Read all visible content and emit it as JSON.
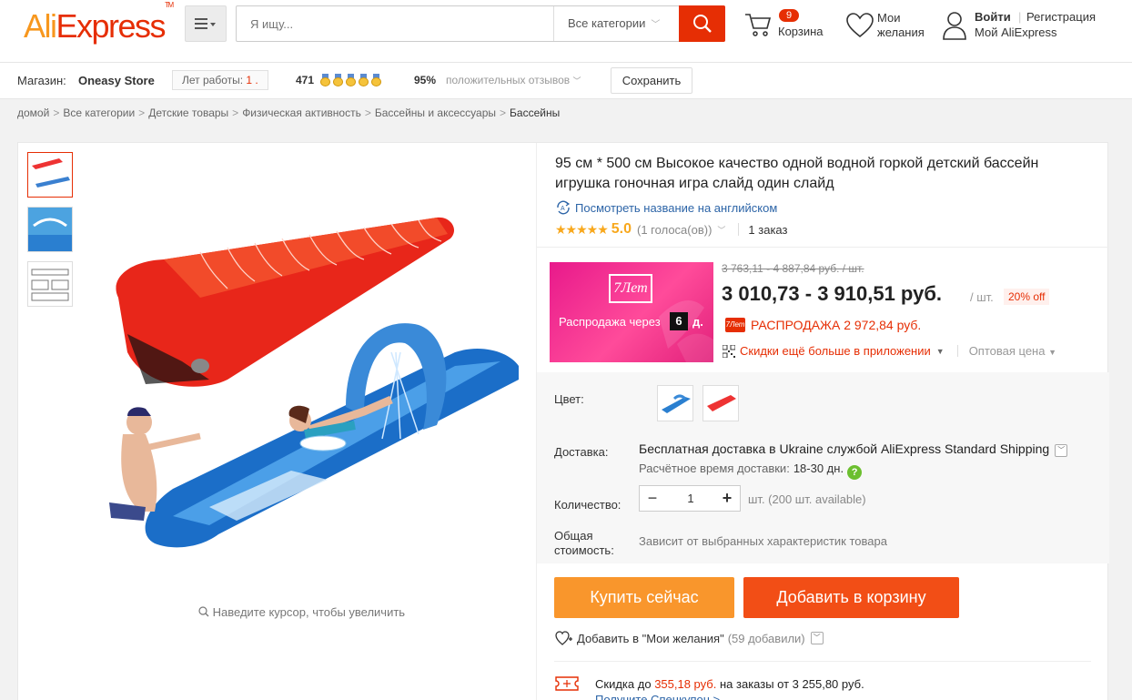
{
  "header": {
    "logo_ali": "Ali",
    "logo_express": "Express",
    "logo_tm": "TM",
    "search_placeholder": "Я ищу...",
    "category_select": "Все категории",
    "cart_count": "9",
    "cart_label": "Корзина",
    "wishlist_line1": "Мои",
    "wishlist_line2": "желания",
    "login": "Войти",
    "register": "Регистрация",
    "my_aliexpress": "Мой AliExpress"
  },
  "store": {
    "label": "Магазин:",
    "name": "Oneasy Store",
    "years_label": "Лет работы:",
    "years_value": "1 .",
    "score": "471",
    "positive_pct": "95%",
    "positive_label": "положительных отзывов",
    "save_button": "Сохранить"
  },
  "breadcrumb": [
    "домой",
    "Все категории",
    "Детские товары",
    "Физическая активность",
    "Бассейны и аксессуары",
    "Бассейны"
  ],
  "gallery": {
    "zoom_hint": "Наведите курсор, чтобы увеличить"
  },
  "product": {
    "title": "95 см * 500 см Высокое качество одной водной горкой детский бассейн игрушка гоночная игра слайд один слайд",
    "translate_link": "Посмотреть название на английском",
    "stars": "★★★★★",
    "rating": "5.0",
    "votes": "(1 голоса(ов))",
    "orders": "1 заказ"
  },
  "promo": {
    "logo": "7Лет",
    "sale_in": "Распродажа через",
    "days": "6",
    "days_unit": "д."
  },
  "pricing": {
    "old_price": "3 763,11 - 4 887,84 руб. / шт.",
    "price": "3 010,73 - 3 910,51 руб.",
    "unit": "/ шт.",
    "discount": "20% off",
    "sale_icon": "7Лет",
    "sale_text": "РАСПРОДАЖА 2 972,84 руб.",
    "app_discount": "Скидки ещё больше в приложении",
    "wholesale": "Оптовая цена"
  },
  "options": {
    "color_label": "Цвет:",
    "shipping_label": "Доставка:",
    "shipping_text": "Бесплатная доставка в Ukraine службой AliExpress Standard Shipping",
    "delivery_time_label": "Расчётное время доставки:",
    "delivery_time_value": "18-30 дн.",
    "quantity_label": "Количество:",
    "quantity_value": "1",
    "quantity_available": "шт. (200 шт. available)",
    "total_label_1": "Общая",
    "total_label_2": "стоимость:",
    "total_value": "Зависит от выбранных характеристик товара"
  },
  "actions": {
    "buy_now": "Купить сейчас",
    "add_to_cart": "Добавить в корзину",
    "add_wishlist": "Добавить в \"Мои желания\"",
    "wishlist_count": "(59 добавили)"
  },
  "coupon": {
    "prefix": "Скидка до",
    "amount": "355,18 руб.",
    "suffix": "на заказы от 3 255,80 руб.",
    "get_link": "Получите Спецкупон >"
  },
  "colors": {
    "brand_orange": "#f7971e",
    "brand_red": "#e62e04",
    "buy_button": "#f9962c",
    "cart_button": "#f24e16",
    "link_blue": "#2c64a7",
    "star_yellow": "#f8a81d",
    "promo_pink": "#e8198b"
  }
}
